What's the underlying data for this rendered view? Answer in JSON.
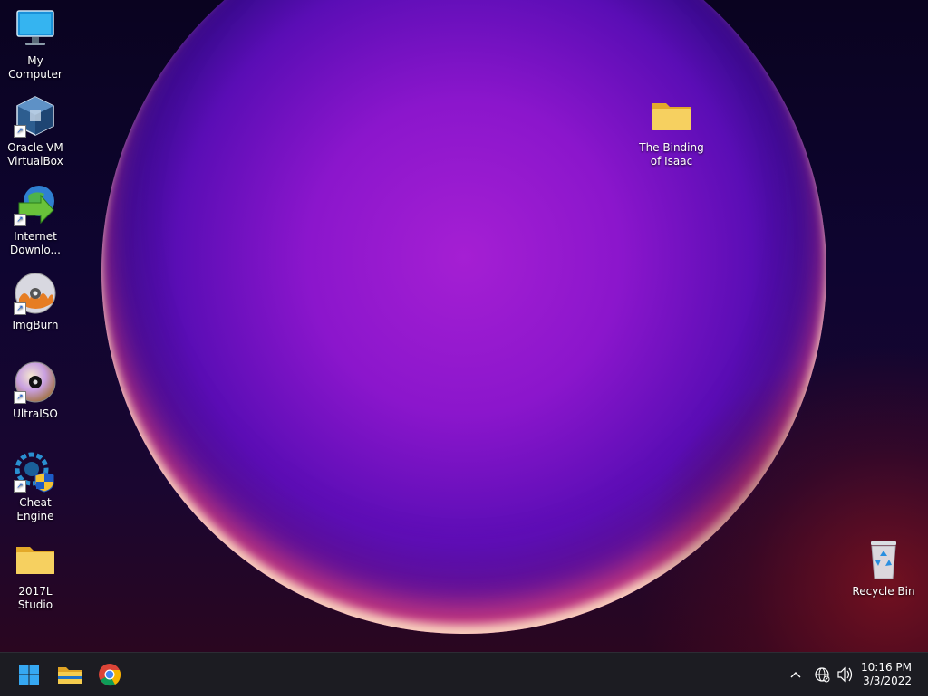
{
  "desktop": {
    "icons": [
      {
        "label": "My Computer"
      },
      {
        "label": "Oracle VM\nVirtualBox"
      },
      {
        "label": "Internet\nDownlo..."
      },
      {
        "label": "ImgBurn"
      },
      {
        "label": "UltraISO"
      },
      {
        "label": "Cheat Engine"
      },
      {
        "label": "2017L Studio"
      },
      {
        "label": "The Binding\nof Isaac"
      },
      {
        "label": "Recycle Bin"
      }
    ]
  },
  "taskbar": {
    "clock_time": "10:16 PM",
    "clock_date": "3/3/2022",
    "pinned": [
      "start-icon",
      "file-explorer-icon",
      "chrome-icon"
    ],
    "tray": [
      "chevron-up-icon",
      "network-globe-icon",
      "volume-icon"
    ]
  },
  "colors": {
    "taskbar_bg": "#1c1c22",
    "folder_yellow": "#f3c74e",
    "start_blue": "#2aa3f0"
  }
}
